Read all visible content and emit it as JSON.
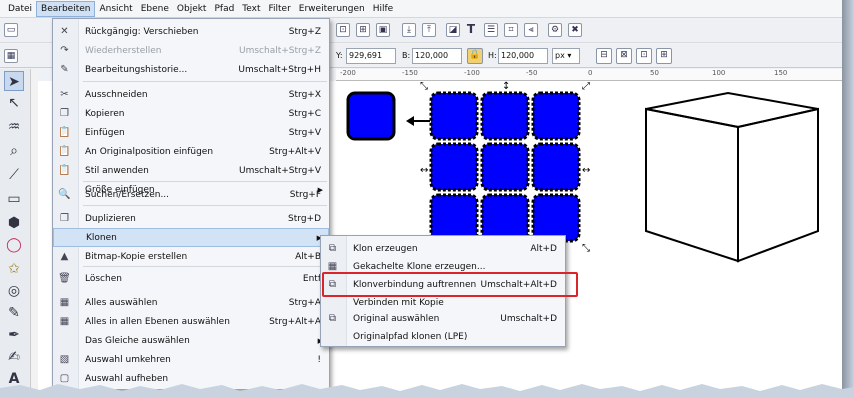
{
  "menubar": [
    "Datei",
    "Bearbeiten",
    "Ansicht",
    "Ebene",
    "Objekt",
    "Pfad",
    "Text",
    "Filter",
    "Erweiterungen",
    "Hilfe"
  ],
  "toolbar2": {
    "y_label": "Y:",
    "y_value": "929,691",
    "b_label": "B:",
    "b_value": "120,000",
    "h_label": "H:",
    "h_value": "120,000",
    "unit": "px"
  },
  "ruler_ticks": [
    "-200",
    "-150",
    "-100",
    "-50",
    "0",
    "50",
    "100",
    "150"
  ],
  "edit_menu": [
    {
      "label": "Rückgängig: Verschieben",
      "shortcut": "Strg+Z",
      "icon": "undo-icon",
      "glyph": "✕"
    },
    {
      "label": "Wiederherstellen",
      "shortcut": "Umschalt+Strg+Z",
      "icon": "redo-icon",
      "glyph": "↷",
      "disabled": true
    },
    {
      "label": "Bearbeitungshistorie...",
      "shortcut": "Umschalt+Strg+H",
      "icon": "history-icon",
      "glyph": "✎"
    },
    {
      "label": "Ausschneiden",
      "shortcut": "Strg+X",
      "icon": "cut-icon",
      "glyph": "✂"
    },
    {
      "label": "Kopieren",
      "shortcut": "Strg+C",
      "icon": "copy-icon",
      "glyph": "❐"
    },
    {
      "label": "Einfügen",
      "shortcut": "Strg+V",
      "icon": "paste-icon",
      "glyph": "📋"
    },
    {
      "label": "An Originalposition einfügen",
      "shortcut": "Strg+Alt+V",
      "icon": "paste-in-place-icon",
      "glyph": "📋"
    },
    {
      "label": "Stil anwenden",
      "shortcut": "Umschalt+Strg+V",
      "icon": "paste-style-icon",
      "glyph": "📋"
    },
    {
      "label": "Größe einfügen",
      "shortcut": "",
      "submenu": true
    },
    {
      "label": "Suchen/Ersetzen...",
      "shortcut": "Strg+F",
      "icon": "find-icon",
      "glyph": "🔍"
    },
    {
      "label": "Duplizieren",
      "shortcut": "Strg+D",
      "icon": "duplicate-icon",
      "glyph": "❐"
    },
    {
      "label": "Klonen",
      "shortcut": "",
      "submenu": true,
      "highlight": true
    },
    {
      "label": "Bitmap-Kopie erstellen",
      "shortcut": "Alt+B",
      "icon": "bitmap-copy-icon",
      "glyph": "▲"
    },
    {
      "label": "Löschen",
      "shortcut": "Entf",
      "icon": "delete-icon",
      "glyph": "🗑"
    },
    {
      "label": "Alles auswählen",
      "shortcut": "Strg+A",
      "icon": "select-all-icon",
      "glyph": "▦"
    },
    {
      "label": "Alles in allen Ebenen auswählen",
      "shortcut": "Strg+Alt+A",
      "icon": "select-all-layers-icon",
      "glyph": "▦"
    },
    {
      "label": "Das Gleiche auswählen",
      "shortcut": "",
      "submenu": true
    },
    {
      "label": "Auswahl umkehren",
      "shortcut": "!",
      "icon": "invert-selection-icon",
      "glyph": "▧"
    },
    {
      "label": "Auswahl aufheben",
      "shortcut": "",
      "icon": "deselect-icon",
      "glyph": "▢"
    }
  ],
  "clone_menu": [
    {
      "label": "Klon erzeugen",
      "shortcut": "Alt+D",
      "icon": "clone-icon",
      "glyph": "⧉"
    },
    {
      "label": "Gekachelte Klone erzeugen...",
      "shortcut": "",
      "icon": "tiled-clones-icon",
      "glyph": "▦"
    },
    {
      "label": "Klonverbindung auftrennen",
      "shortcut": "Umschalt+Alt+D",
      "icon": "unlink-clone-icon",
      "glyph": "⧉"
    },
    {
      "label": "Verbinden mit Kopie",
      "shortcut": ""
    },
    {
      "label": "Original auswählen",
      "shortcut": "Umschalt+D",
      "icon": "select-original-icon",
      "glyph": "⧉"
    },
    {
      "label": "Originalpfad klonen (LPE)",
      "shortcut": ""
    }
  ]
}
